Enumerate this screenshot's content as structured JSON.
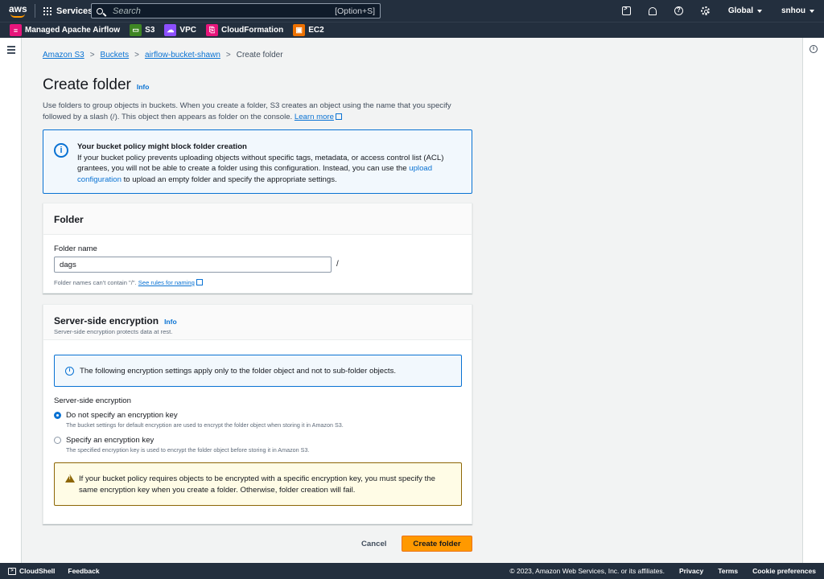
{
  "topnav": {
    "logo_text": "aws",
    "services_label": "Services",
    "search_placeholder": "Search",
    "search_shortcut": "[Option+S]",
    "region_label": "Global",
    "user_label": "snhou"
  },
  "favorites": [
    {
      "label": "Managed Apache Airflow",
      "color": "#e7157b"
    },
    {
      "label": "S3",
      "color": "#3f8624"
    },
    {
      "label": "VPC",
      "color": "#8c4fff"
    },
    {
      "label": "CloudFormation",
      "color": "#e7157b"
    },
    {
      "label": "EC2",
      "color": "#ed7100"
    }
  ],
  "breadcrumb": {
    "items": [
      "Amazon S3",
      "Buckets",
      "airflow-bucket-shawn"
    ],
    "current": "Create folder"
  },
  "page": {
    "title": "Create folder",
    "info_label": "Info",
    "description": "Use folders to group objects in buckets. When you create a folder, S3 creates an object using the name that you specify followed by a slash (/). This object then appears as folder on the console.",
    "learn_more": "Learn more"
  },
  "policy_alert": {
    "title": "Your bucket policy might block folder creation",
    "body_before": "If your bucket policy prevents uploading objects without specific tags, metadata, or access control list (ACL) grantees, you will not be able to create a folder using this configuration. Instead, you can use the",
    "link": "upload configuration",
    "body_after": "to upload an empty folder and specify the appropriate settings."
  },
  "folder_panel": {
    "heading": "Folder",
    "field_label": "Folder name",
    "field_value": "dags",
    "suffix": "/",
    "constraint_text": "Folder names can't contain \"/\".",
    "constraint_link": "See rules for naming"
  },
  "encryption_panel": {
    "heading": "Server-side encryption",
    "info_label": "Info",
    "subheading": "Server-side encryption protects data at rest.",
    "note": "The following encryption settings apply only to the folder object and not to sub-folder objects.",
    "group_label": "Server-side encryption",
    "options": [
      {
        "label": "Do not specify an encryption key",
        "desc": "The bucket settings for default encryption are used to encrypt the folder object when storing it in Amazon S3.",
        "checked": true
      },
      {
        "label": "Specify an encryption key",
        "desc": "The specified encryption key is used to encrypt the folder object before storing it in Amazon S3.",
        "checked": false
      }
    ],
    "warning": "If your bucket policy requires objects to be encrypted with a specific encryption key, you must specify the same encryption key when you create a folder. Otherwise, folder creation will fail."
  },
  "actions": {
    "cancel": "Cancel",
    "submit": "Create folder"
  },
  "footer": {
    "cloudshell": "CloudShell",
    "feedback": "Feedback",
    "copyright": "© 2023, Amazon Web Services, Inc. or its affiliates.",
    "privacy": "Privacy",
    "terms": "Terms",
    "cookies": "Cookie preferences"
  }
}
